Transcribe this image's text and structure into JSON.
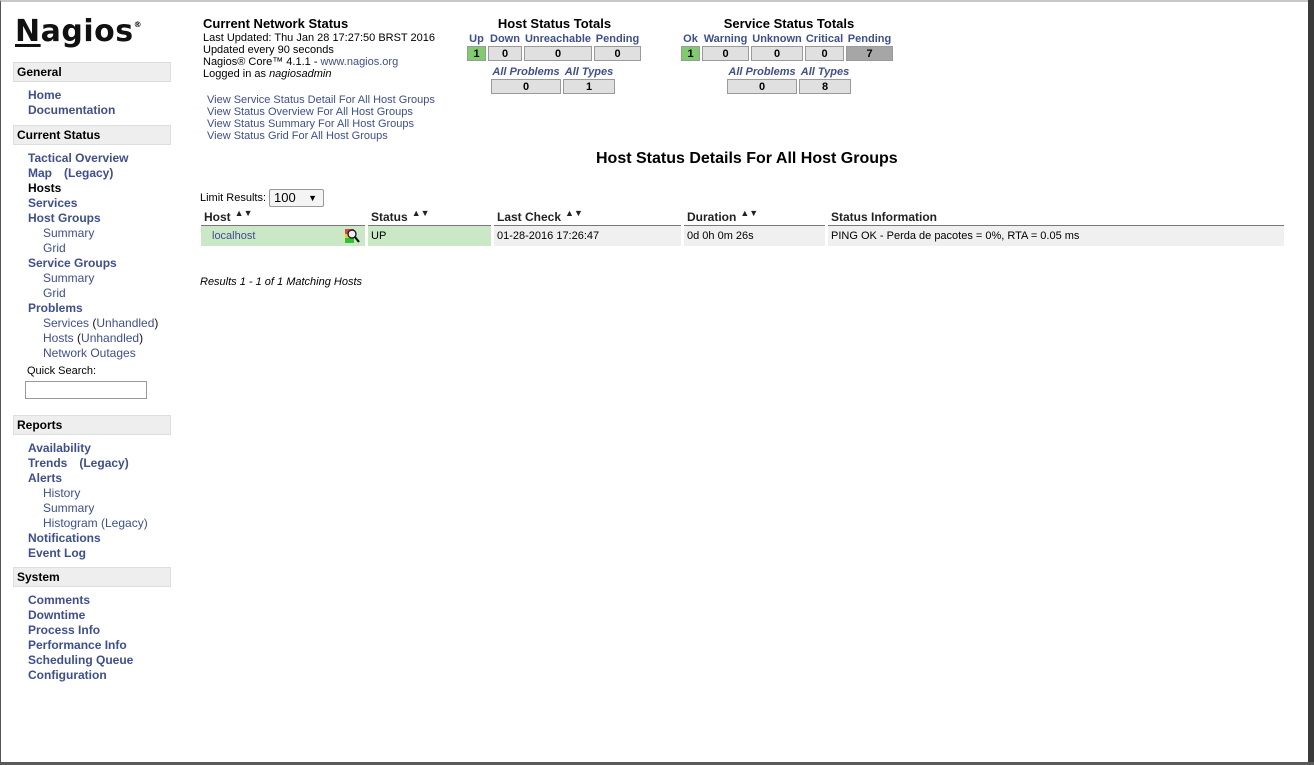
{
  "brand": {
    "logo_text": "Nagios",
    "logo_mark": "®"
  },
  "sidebar": {
    "sections": [
      {
        "title": "General",
        "items": [
          {
            "label": "Home",
            "level": 1
          },
          {
            "label": "Documentation",
            "level": 1
          }
        ]
      },
      {
        "title": "Current Status",
        "items": [
          {
            "label": "Tactical Overview",
            "level": 1
          },
          {
            "label": "Map",
            "suffix": "(Legacy)",
            "level": 1
          },
          {
            "label": "Hosts",
            "level": 1,
            "active": true
          },
          {
            "label": "Services",
            "level": 1
          },
          {
            "label": "Host Groups",
            "level": 1
          },
          {
            "label": "Summary",
            "level": 2
          },
          {
            "label": "Grid",
            "level": 2
          },
          {
            "label": "Service Groups",
            "level": 1
          },
          {
            "label": "Summary",
            "level": 2
          },
          {
            "label": "Grid",
            "level": 2
          },
          {
            "label": "Problems",
            "level": 1
          },
          {
            "label": "Services",
            "paren": "Unhandled",
            "level": 2
          },
          {
            "label": "Hosts",
            "paren": "Unhandled",
            "level": 2
          },
          {
            "label": "Network Outages",
            "level": 2
          }
        ]
      },
      {
        "title": "Reports",
        "items": [
          {
            "label": "Availability",
            "level": 1
          },
          {
            "label": "Trends",
            "suffix": "(Legacy)",
            "level": 1
          },
          {
            "label": "Alerts",
            "level": 1
          },
          {
            "label": "History",
            "level": 2
          },
          {
            "label": "Summary",
            "level": 2
          },
          {
            "label": "Histogram (Legacy)",
            "level": 2
          },
          {
            "label": "Notifications",
            "level": 1
          },
          {
            "label": "Event Log",
            "level": 1
          }
        ]
      },
      {
        "title": "System",
        "items": [
          {
            "label": "Comments",
            "level": 1
          },
          {
            "label": "Downtime",
            "level": 1
          },
          {
            "label": "Process Info",
            "level": 1
          },
          {
            "label": "Performance Info",
            "level": 1
          },
          {
            "label": "Scheduling Queue",
            "level": 1
          },
          {
            "label": "Configuration",
            "level": 1
          }
        ]
      }
    ],
    "quick_search": {
      "label": "Quick Search:",
      "value": ""
    }
  },
  "network_status": {
    "title": "Current Network Status",
    "last_updated": "Last Updated: Thu Jan 28 17:27:50 BRST 2016",
    "update_interval": "Updated every 90 seconds",
    "version_prefix": "Nagios® Core™ 4.1.1 - ",
    "version_link": "www.nagios.org",
    "logged_in_prefix": "Logged in as ",
    "user": "nagiosadmin"
  },
  "view_links": [
    "View Service Status Detail For All Host Groups",
    "View Status Overview For All Host Groups",
    "View Status Summary For All Host Groups",
    "View Status Grid For All Host Groups"
  ],
  "host_totals": {
    "title": "Host Status Totals",
    "states": [
      {
        "label": "Up",
        "value": "1",
        "style": "green"
      },
      {
        "label": "Down",
        "value": "0"
      },
      {
        "label": "Unreachable",
        "value": "0"
      },
      {
        "label": "Pending",
        "value": "0"
      }
    ],
    "summary": [
      {
        "label": "All Problems",
        "value": "0"
      },
      {
        "label": "All Types",
        "value": "1"
      }
    ]
  },
  "service_totals": {
    "title": "Service Status Totals",
    "states": [
      {
        "label": "Ok",
        "value": "1",
        "style": "green"
      },
      {
        "label": "Warning",
        "value": "0"
      },
      {
        "label": "Unknown",
        "value": "0"
      },
      {
        "label": "Critical",
        "value": "0"
      },
      {
        "label": "Pending",
        "value": "7",
        "style": "pending"
      }
    ],
    "summary": [
      {
        "label": "All Problems",
        "value": "0"
      },
      {
        "label": "All Types",
        "value": "8"
      }
    ]
  },
  "main": {
    "page_title": "Host Status Details For All Host Groups",
    "limit_label": "Limit Results:",
    "limit_value": "100",
    "columns": [
      "Host",
      "Status",
      "Last Check",
      "Duration",
      "Status Information"
    ],
    "rows": [
      {
        "host": "localhost",
        "status": "UP",
        "last_check": "01-28-2016 17:26:47",
        "duration": "0d 0h 0m 26s",
        "info": "PING OK - Perda de pacotes = 0%, RTA = 0.05 ms"
      }
    ],
    "results_text": "Results 1 - 1 of 1 Matching Hosts"
  },
  "colors": {
    "link": "#3d4f8f",
    "up": "#cbe8c6",
    "ok_total": "#7ecc6b",
    "pending_total": "#a6a6a6"
  }
}
